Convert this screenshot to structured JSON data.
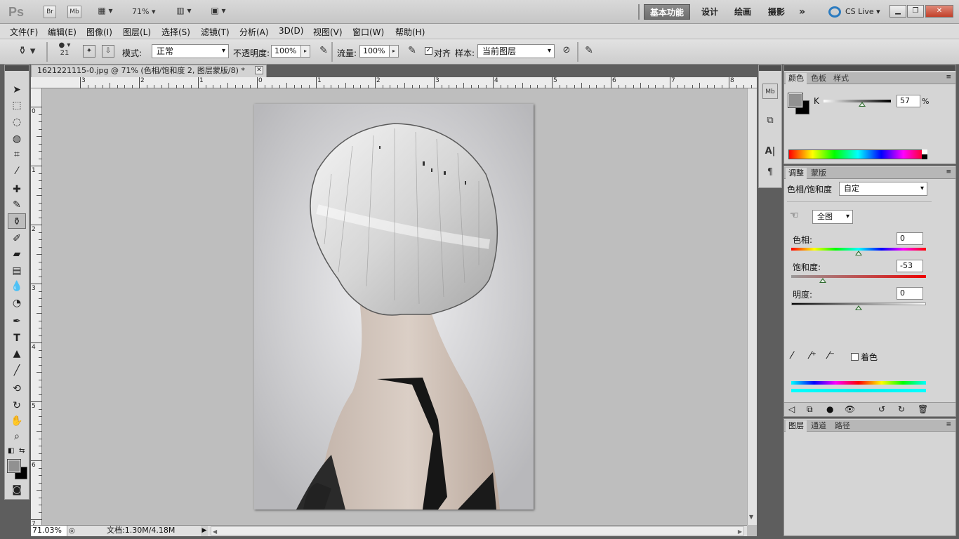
{
  "app": {
    "logo": "Ps",
    "zoom": "71%",
    "buttons": {
      "br": "Br",
      "mb": "Mb"
    }
  },
  "workspaces": [
    "基本功能",
    "设计",
    "绘画",
    "摄影"
  ],
  "workspace_more": "»",
  "cs_live": "CS Live",
  "menu": [
    "文件(F)",
    "编辑(E)",
    "图像(I)",
    "图层(L)",
    "选择(S)",
    "滤镜(T)",
    "分析(A)",
    "3D(D)",
    "视图(V)",
    "窗口(W)",
    "帮助(H)"
  ],
  "options": {
    "brush_size": "21",
    "mode_label": "模式:",
    "mode_value": "正常",
    "opacity_label": "不透明度:",
    "opacity_value": "100%",
    "flow_label": "流量:",
    "flow_value": "100%",
    "aligned_label": "对齐",
    "sample_label": "样本:",
    "sample_value": "当前图层"
  },
  "document": {
    "tab_title": "1621221115-0.jpg @ 71% (色相/饱和度 2, 图层蒙版/8) *",
    "zoom_status": "71.03%",
    "doc_info": "文档:1.30M/4.18M"
  },
  "rulers": {
    "h_labels": [
      "3",
      "2",
      "1",
      "0",
      "1",
      "2",
      "3",
      "4",
      "5",
      "6",
      "7",
      "8"
    ],
    "v_labels": [
      "0",
      "1",
      "2",
      "3",
      "4",
      "5",
      "6",
      "7"
    ]
  },
  "color_panel": {
    "tabs": [
      "颜色",
      "色板",
      "样式"
    ],
    "channel_label": "K",
    "channel_value": "57",
    "unit": "%",
    "k_level": 0.57
  },
  "adjust_panel": {
    "tabs": [
      "调整",
      "蒙版"
    ],
    "title": "色相/饱和度",
    "preset": "自定",
    "range": "全图",
    "hue_label": "色相:",
    "hue_value": "0",
    "sat_label": "饱和度:",
    "sat_value": "-53",
    "light_label": "明度:",
    "light_value": "0",
    "colorize_label": "着色",
    "hue_level": 0.5,
    "sat_level": 0.235,
    "light_level": 0.5
  },
  "layers_panel": {
    "tabs": [
      "图层",
      "通道",
      "路径"
    ]
  },
  "colors": {
    "active_workspace": "#7a7a7a",
    "panel_bg": "#d5d5d5",
    "fg_swatch": "#919191",
    "bg_swatch": "#000000"
  }
}
